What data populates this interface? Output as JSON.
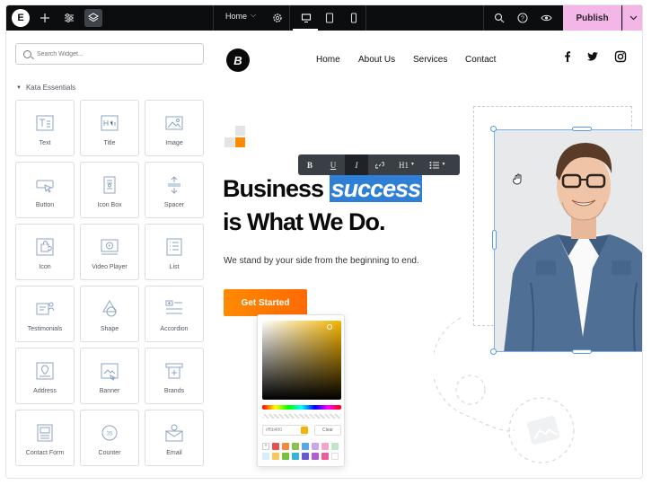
{
  "topbar": {
    "logo_letter": "E",
    "page_name": "Home",
    "publish_label": "Publish",
    "icons": [
      "plus-icon",
      "sliders-icon",
      "layers-icon",
      "gear-icon",
      "desktop-icon",
      "tablet-icon",
      "mobile-icon",
      "search-icon",
      "help-icon",
      "eye-icon",
      "chevron-down-icon"
    ]
  },
  "sidebar": {
    "search_placeholder": "Search Widget...",
    "section_title": "Kata Essentials",
    "widgets": [
      {
        "label": "Text",
        "icon": "text-icon"
      },
      {
        "label": "Title",
        "icon": "title-icon"
      },
      {
        "label": "Image",
        "icon": "image-icon"
      },
      {
        "label": "Button",
        "icon": "button-icon"
      },
      {
        "label": "Icon Box",
        "icon": "icon-box-icon"
      },
      {
        "label": "Spacer",
        "icon": "spacer-icon"
      },
      {
        "label": "Icon",
        "icon": "puzzle-icon"
      },
      {
        "label": "Video Player",
        "icon": "video-player-icon"
      },
      {
        "label": "List",
        "icon": "list-icon"
      },
      {
        "label": "Testimonials",
        "icon": "testimonials-icon"
      },
      {
        "label": "Shape",
        "icon": "shape-icon"
      },
      {
        "label": "Accordion",
        "icon": "accordion-icon"
      },
      {
        "label": "Address",
        "icon": "address-icon"
      },
      {
        "label": "Banner",
        "icon": "banner-icon"
      },
      {
        "label": "Brands",
        "icon": "brands-icon"
      },
      {
        "label": "Contact Form",
        "icon": "contact-form-icon"
      },
      {
        "label": "Counter",
        "icon": "counter-icon"
      },
      {
        "label": "Email",
        "icon": "email-icon"
      }
    ]
  },
  "canvas": {
    "site_logo_letter": "B",
    "nav": [
      "Home",
      "About Us",
      "Services",
      "Contact"
    ],
    "social": [
      "facebook-icon",
      "twitter-icon",
      "instagram-icon"
    ],
    "headline_word1": "Business",
    "headline_highlight": "success",
    "headline_line2": "is What We Do.",
    "subtext": "We stand by your side from the beginning to end.",
    "cta_label": "Get Started",
    "toolbar": {
      "bold": "B",
      "underline": "U",
      "italic": "I",
      "heading": "H1"
    },
    "picker": {
      "hex_value": "#f5b400",
      "clear_label": "Clear",
      "presets": [
        "#e94f4f",
        "#f08b3c",
        "#8bc34a",
        "#5aa9e6",
        "#c9a7f0",
        "#f4a6c9",
        "#bfe6c8",
        "#d6eef7",
        "#f8c85a",
        "#7ac142",
        "#36b3d9",
        "#6a5acd",
        "#b45cd8",
        "#e85d9a",
        "#ffffff",
        "#ffffff"
      ]
    },
    "colors": {
      "accent": "#ff7a00",
      "highlight": "#2f7fd6",
      "publish": "#f3b6e6"
    }
  }
}
